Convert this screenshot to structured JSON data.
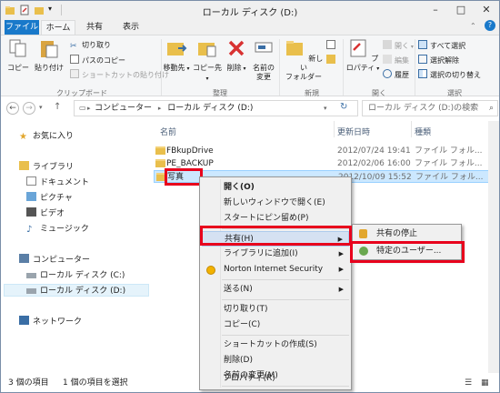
{
  "window": {
    "title": "ローカル ディスク (D:)"
  },
  "tabs": {
    "file": "ファイル",
    "home": "ホーム",
    "share": "共有",
    "view": "表示"
  },
  "ribbon": {
    "copy": "コピー",
    "paste": "貼り付け",
    "cut": "切り取り",
    "copy_path": "パスのコピー",
    "paste_shortcut": "ショートカットの貼り付け",
    "clipboard_group": "クリップボード",
    "move_to": "移動先",
    "copy_to": "コピー先",
    "delete": "削除",
    "rename_line1": "名前の",
    "rename_line2": "変更",
    "organize_group": "整理",
    "new_folder_line1": "新しい",
    "new_folder_line2": "フォルダー",
    "new_group": "新規",
    "properties": "プロパティ",
    "open": "開く",
    "edit": "編集",
    "history": "履歴",
    "open_group": "開く",
    "select_all": "すべて選択",
    "select_none": "選択解除",
    "invert_selection": "選択の切り替え",
    "select_group": "選択"
  },
  "address": {
    "path_computer": "コンピューター",
    "path_disk": "ローカル ディスク (D:)",
    "search_placeholder": "ローカル ディスク (D:)の検索"
  },
  "navpane": {
    "favorites": "お気に入り",
    "libraries": "ライブラリ",
    "documents": "ドキュメント",
    "pictures": "ピクチャ",
    "videos": "ビデオ",
    "music": "ミュージック",
    "computer": "コンピューター",
    "disk_c": "ローカル ディスク (C:)",
    "disk_d": "ローカル ディスク (D:)",
    "network": "ネットワーク"
  },
  "columns": {
    "name": "名前",
    "date": "更新日時",
    "type": "種類"
  },
  "files": [
    {
      "name": "FBkupDrive",
      "date": "2012/07/24 19:41",
      "type": "ファイル フォル..."
    },
    {
      "name": "PE_BACKUP",
      "date": "2012/02/06 16:00",
      "type": "ファイル フォル..."
    },
    {
      "name": "写真",
      "date": "2012/10/09 15:52",
      "type": "ファイル フォル..."
    }
  ],
  "status": {
    "item_count": "3 個の項目",
    "selected": "1 個の項目を選択"
  },
  "context_menu": {
    "open": "開く(O)",
    "open_new_window": "新しいウィンドウで開く(E)",
    "pin_start": "スタートにピン留め(P)",
    "share": "共有(H)",
    "add_library": "ライブラリに追加(I)",
    "norton": "Norton Internet Security",
    "send_to": "送る(N)",
    "cut": "切り取り(T)",
    "copy": "コピー(C)",
    "create_shortcut": "ショートカットの作成(S)",
    "delete": "削除(D)",
    "rename": "名前の変更(M)",
    "properties": "プロパティ(R)"
  },
  "submenu": {
    "stop_sharing": "共有の停止",
    "specific_users": "特定のユーザー..."
  },
  "colors": {
    "accent": "#1979ca",
    "highlight_box": "#e8001c",
    "selection": "#cce8ff"
  }
}
